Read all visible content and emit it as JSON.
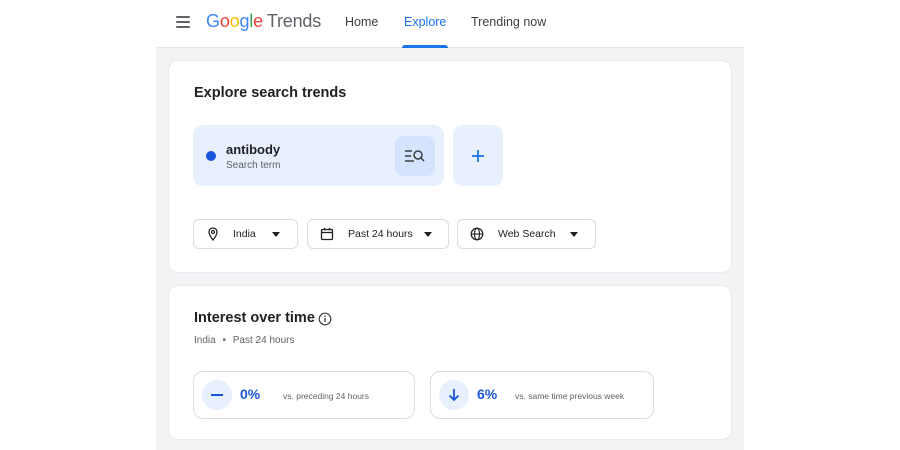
{
  "header": {
    "logo_parts": [
      "G",
      "o",
      "o",
      "g",
      "l",
      "e"
    ],
    "logo_suffix": "Trends",
    "tabs": [
      {
        "label": "Home"
      },
      {
        "label": "Explore"
      },
      {
        "label": "Trending now"
      }
    ],
    "active_tab": "Explore"
  },
  "explore": {
    "title": "Explore search trends",
    "term": {
      "name": "antibody",
      "type": "Search term",
      "color": "#1a56db"
    },
    "filters": {
      "location": "India",
      "time": "Past 24 hours",
      "property": "Web Search"
    }
  },
  "interest": {
    "title": "Interest over time",
    "location": "India",
    "separator": "•",
    "period": "Past 24 hours",
    "stats": [
      {
        "value": "0%",
        "label": "vs. preceding 24 hours",
        "icon": "minus-icon"
      },
      {
        "value": "6%",
        "label": "vs. same time previous week",
        "icon": "arrow-down-icon"
      }
    ]
  },
  "colors": {
    "accent": "#1a73e8",
    "term_dot": "#1a56db",
    "chip_background": "#e8f0fe",
    "page_background": "#f1f3f4"
  }
}
